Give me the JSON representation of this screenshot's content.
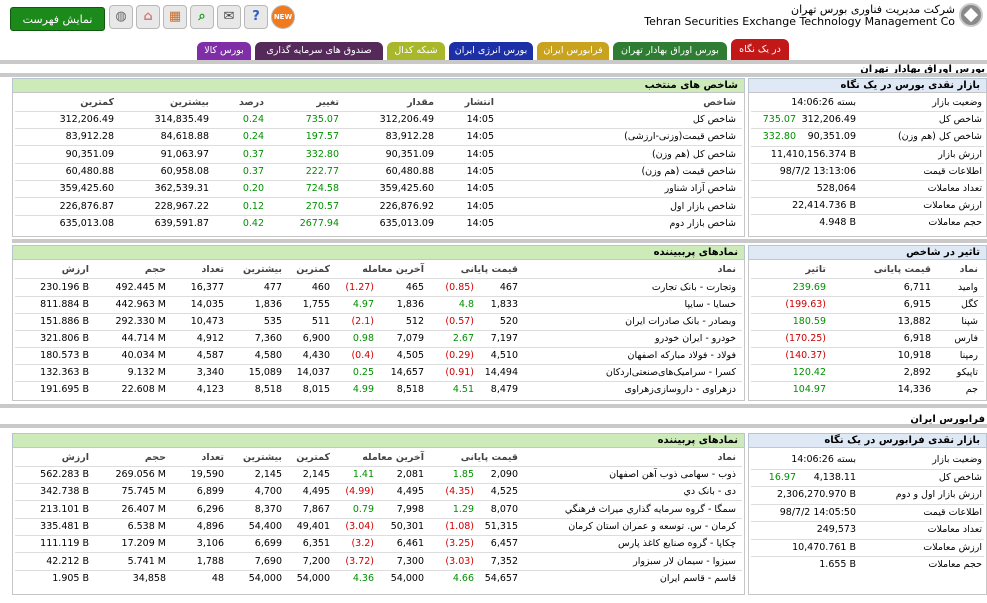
{
  "header": {
    "org_fa": "شرکت مدیریت فناوری بورس تهران",
    "org_en": "Tehran Securities Exchange Technology Management Co",
    "show_menu": "نمایش فهرست"
  },
  "tabs": [
    "در یک نگاه",
    "بورس اوراق بهادار تهران",
    "فرابورس ایران",
    "بورس انرژی ایران",
    "شبکه کدال",
    "صندوق های سرمایه گذاری",
    "بورس کالا"
  ],
  "colors": {
    "active_tab": "#c21818",
    "header_green": "#ccebb8",
    "header_blue": "#dfe9f5"
  },
  "section1": "بورس اوراق بهادار تهران",
  "cash": {
    "title": "بازار نقدی بورس در یک نگاه",
    "rows": [
      {
        "l": "وضعیت بازار",
        "v": "بسته 14:06:26",
        "d": ""
      },
      {
        "l": "شاخص کل",
        "v": "312,206.49",
        "d": "735.07"
      },
      {
        "l": "شاخص کل (هم وزن)",
        "v": "90,351.09",
        "d": "332.80"
      },
      {
        "l": "ارزش بازار",
        "v": "11,410,156.374 B",
        "d": ""
      },
      {
        "l": "اطلاعات قیمت",
        "v": "98/7/2 13:13:06",
        "d": ""
      },
      {
        "l": "تعداد معاملات",
        "v": "528,064",
        "d": ""
      },
      {
        "l": "ارزش معاملات",
        "v": "22,414.736 B",
        "d": ""
      },
      {
        "l": "حجم معاملات",
        "v": "4.948 B",
        "d": ""
      }
    ]
  },
  "indices": {
    "title": "شاخص های منتخب",
    "cols": [
      "شاخص",
      "انتشار",
      "مقدار",
      "تغییر",
      "درصد",
      "بیشترین",
      "کمترین"
    ],
    "rows": [
      [
        "شاخص کل",
        "14:05",
        "312,206.49",
        "735.07",
        "0.24",
        "314,835.49",
        "312,206.49"
      ],
      [
        "شاخص قیمت(وزنی-ارزشی)",
        "14:05",
        "83,912.28",
        "197.57",
        "0.24",
        "84,618.88",
        "83,912.28"
      ],
      [
        "شاخص کل (هم وزن)",
        "14:05",
        "90,351.09",
        "332.80",
        "0.37",
        "91,063.97",
        "90,351.09"
      ],
      [
        "شاخص قیمت (هم وزن)",
        "14:05",
        "60,480.88",
        "222.77",
        "0.37",
        "60,958.08",
        "60,480.88"
      ],
      [
        "شاخص آزاد شناور",
        "14:05",
        "359,425.60",
        "724.58",
        "0.20",
        "362,539.31",
        "359,425.60"
      ],
      [
        "شاخص بازار اول",
        "14:05",
        "226,876.92",
        "270.57",
        "0.12",
        "228,967.22",
        "226,876.87"
      ],
      [
        "شاخص بازار دوم",
        "14:05",
        "635,013.09",
        "2677.94",
        "0.42",
        "639,591.87",
        "635,013.08"
      ]
    ]
  },
  "impact": {
    "title": "تاثیر در شاخص",
    "cols": [
      "نماد",
      "قیمت پایانی",
      "تاثیر"
    ],
    "rows": [
      [
        "وامید",
        "6,711",
        "239.69",
        "g"
      ],
      [
        "کگل",
        "6,915",
        "(199.63)",
        "red"
      ],
      [
        "شپنا",
        "13,882",
        "180.59",
        "g"
      ],
      [
        "فارس",
        "6,918",
        "(170.25)",
        "red"
      ],
      [
        "رمپنا",
        "10,918",
        "(140.37)",
        "red"
      ],
      [
        "تاپیکو",
        "2,892",
        "120.42",
        "g"
      ],
      [
        "جم",
        "14,336",
        "104.97",
        "g"
      ]
    ]
  },
  "active": {
    "title": "نمادهای پرببیننده",
    "cols": [
      "نماد",
      "قیمت پایانی",
      "",
      "آخرین معامله",
      "",
      "کمترین",
      "بیشترین",
      "تعداد",
      "حجم",
      "ارزش"
    ],
    "rows": [
      [
        "وتجارت - بانک تجارت",
        "467",
        "(0.85)",
        "465",
        "(1.27)",
        "460",
        "477",
        "16,377",
        "492.445 M",
        "230.196 B",
        "red",
        "red"
      ],
      [
        "خسایا - سایپا",
        "1,833",
        "4.8",
        "1,836",
        "4.97",
        "1,755",
        "1,836",
        "14,035",
        "442.963 M",
        "811.884 B",
        "g",
        "g"
      ],
      [
        "وبصادر - بانک صادرات ایران",
        "520",
        "(0.57)",
        "512",
        "(2.1)",
        "511",
        "535",
        "10,473",
        "292.330 M",
        "151.886 B",
        "red",
        "red"
      ],
      [
        "خودرو - ایران خودرو",
        "7,197",
        "2.67",
        "7,079",
        "0.98",
        "6,900",
        "7,360",
        "4,912",
        "44.714 M",
        "321.806 B",
        "g",
        "g"
      ],
      [
        "فولاد - فولاد مبارکه اصفهان",
        "4,510",
        "(0.29)",
        "4,505",
        "(0.4)",
        "4,430",
        "4,580",
        "4,587",
        "40.034 M",
        "180.573 B",
        "red",
        "red"
      ],
      [
        "کسرا - سرامیک‌های‌صنعتی‌اردکان",
        "14,494",
        "(0.91)",
        "14,657",
        "0.25",
        "14,037",
        "15,089",
        "3,340",
        "9.132 M",
        "132.363 B",
        "red",
        "g"
      ],
      [
        "دزهراوی - داروسازی‌زهراوی",
        "8,479",
        "4.51",
        "8,518",
        "4.99",
        "8,015",
        "8,518",
        "4,123",
        "22.608 M",
        "191.695 B",
        "g",
        "g"
      ]
    ]
  },
  "section2": "فرابورس ایران",
  "ifb": {
    "title": "بازار نقدی فرابورس در یک نگاه",
    "rows": [
      {
        "l": "وضعیت بازار",
        "v": "بسته 14:06:26",
        "d": ""
      },
      {
        "l": "شاخص کل",
        "v": "4,138.11",
        "d": "16.97"
      },
      {
        "l": "ارزش بازار اول و دوم",
        "v": "2,306,270.970 B",
        "d": ""
      },
      {
        "l": "اطلاعات قیمت",
        "v": "98/7/2 14:05:50",
        "d": ""
      },
      {
        "l": "تعداد معاملات",
        "v": "249,573",
        "d": ""
      },
      {
        "l": "ارزش معاملات",
        "v": "10,470.761 B",
        "d": ""
      },
      {
        "l": "حجم معاملات",
        "v": "1.655 B",
        "d": ""
      }
    ]
  },
  "ifbactive": {
    "title": "نمادهای پربیننده",
    "cols": [
      "نماد",
      "قیمت پایانی",
      "",
      "آخرین معامله",
      "",
      "کمترین",
      "بیشترین",
      "تعداد",
      "حجم",
      "ارزش"
    ],
    "rows": [
      [
        "ذوب - سهامی ذوب آهن اصفهان",
        "2,090",
        "1.85",
        "2,081",
        "1.41",
        "2,145",
        "2,145",
        "19,590",
        "269.056 M",
        "562.283 B",
        "g",
        "g"
      ],
      [
        "دی - بانک دي",
        "4,525",
        "(4.35)",
        "4,495",
        "(4.99)",
        "4,495",
        "4,700",
        "6,899",
        "75.745 M",
        "342.738 B",
        "red",
        "red"
      ],
      [
        "سمگا - گروه سرمايه گذاري ميراث فرهنگي",
        "8,070",
        "1.29",
        "7,998",
        "0.79",
        "7,867",
        "8,370",
        "6,296",
        "26.407 M",
        "213.101 B",
        "g",
        "g"
      ],
      [
        "کرمان - س. توسعه و عمران استان کرمان",
        "51,315",
        "(1.08)",
        "50,301",
        "(3.04)",
        "49,401",
        "54,400",
        "4,896",
        "6.538 M",
        "335.481 B",
        "red",
        "red"
      ],
      [
        "چکاپا - گروه صنايع کاغذ پارس",
        "6,457",
        "(3.25)",
        "6,461",
        "(3.2)",
        "6,351",
        "6,699",
        "3,106",
        "17.209 M",
        "111.119 B",
        "red",
        "red"
      ],
      [
        "سیزوا - سيمان لار سبزوار",
        "7,352",
        "(3.03)",
        "7,300",
        "(3.72)",
        "7,200",
        "7,690",
        "1,788",
        "5.741 M",
        "42.212 B",
        "red",
        "red"
      ],
      [
        "قاسم - قاسم ايران",
        "54,657",
        "4.66",
        "54,000",
        "4.36",
        "54,000",
        "54,000",
        "48",
        "34,858",
        "1.905 B",
        "g",
        "g"
      ]
    ]
  }
}
